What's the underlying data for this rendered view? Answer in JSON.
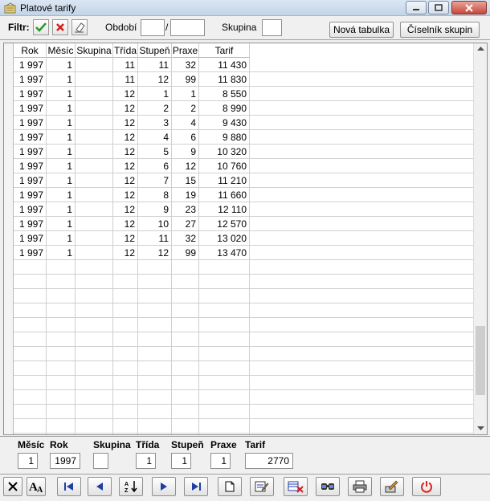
{
  "window": {
    "title": "Platové tarify"
  },
  "filter": {
    "label": "Filtr:",
    "period_label": "Období",
    "period_from": "",
    "period_sep": "/",
    "period_to": "",
    "group_label": "Skupina",
    "group_value": "",
    "new_table_label": "Nová tabulka",
    "group_catalog_label": "Číselník skupin"
  },
  "grid": {
    "columns": [
      "Rok",
      "Měsíc",
      "Skupina",
      "Třída",
      "Stupeň",
      "Praxe",
      "Tarif"
    ],
    "rows": [
      [
        "1 997",
        "1",
        "",
        "11",
        "11",
        "32",
        "11 430"
      ],
      [
        "1 997",
        "1",
        "",
        "11",
        "12",
        "99",
        "11 830"
      ],
      [
        "1 997",
        "1",
        "",
        "12",
        "1",
        "1",
        "8 550"
      ],
      [
        "1 997",
        "1",
        "",
        "12",
        "2",
        "2",
        "8 990"
      ],
      [
        "1 997",
        "1",
        "",
        "12",
        "3",
        "4",
        "9 430"
      ],
      [
        "1 997",
        "1",
        "",
        "12",
        "4",
        "6",
        "9 880"
      ],
      [
        "1 997",
        "1",
        "",
        "12",
        "5",
        "9",
        "10 320"
      ],
      [
        "1 997",
        "1",
        "",
        "12",
        "6",
        "12",
        "10 760"
      ],
      [
        "1 997",
        "1",
        "",
        "12",
        "7",
        "15",
        "11 210"
      ],
      [
        "1 997",
        "1",
        "",
        "12",
        "8",
        "19",
        "11 660"
      ],
      [
        "1 997",
        "1",
        "",
        "12",
        "9",
        "23",
        "12 110"
      ],
      [
        "1 997",
        "1",
        "",
        "12",
        "10",
        "27",
        "12 570"
      ],
      [
        "1 997",
        "1",
        "",
        "12",
        "11",
        "32",
        "13 020"
      ],
      [
        "1 997",
        "1",
        "",
        "12",
        "12",
        "99",
        "13 470"
      ]
    ]
  },
  "detail": {
    "mesic_label": "Měsíc",
    "mesic": "1",
    "rok_label": "Rok",
    "rok": "1997",
    "skupina_label": "Skupina",
    "skupina": "",
    "trida_label": "Třída",
    "trida": "1",
    "stupen_label": "Stupeň",
    "stupen": "1",
    "praxe_label": "Praxe",
    "praxe": "1",
    "tarif_label": "Tarif",
    "tarif": "2770"
  },
  "toolbar": {
    "icons": [
      "cancel-icon",
      "font-icon",
      "first-record-icon",
      "previous-record-icon",
      "sort-icon",
      "next-record-icon",
      "last-record-icon",
      "new-record-icon",
      "edit-record-icon",
      "delete-record-icon",
      "search-icon",
      "print-icon",
      "export-icon",
      "power-icon"
    ]
  },
  "colors": {
    "accept": "#2a9a2a",
    "reject": "#d42020",
    "power": "#e02020",
    "nav": "#1f3fa8"
  }
}
